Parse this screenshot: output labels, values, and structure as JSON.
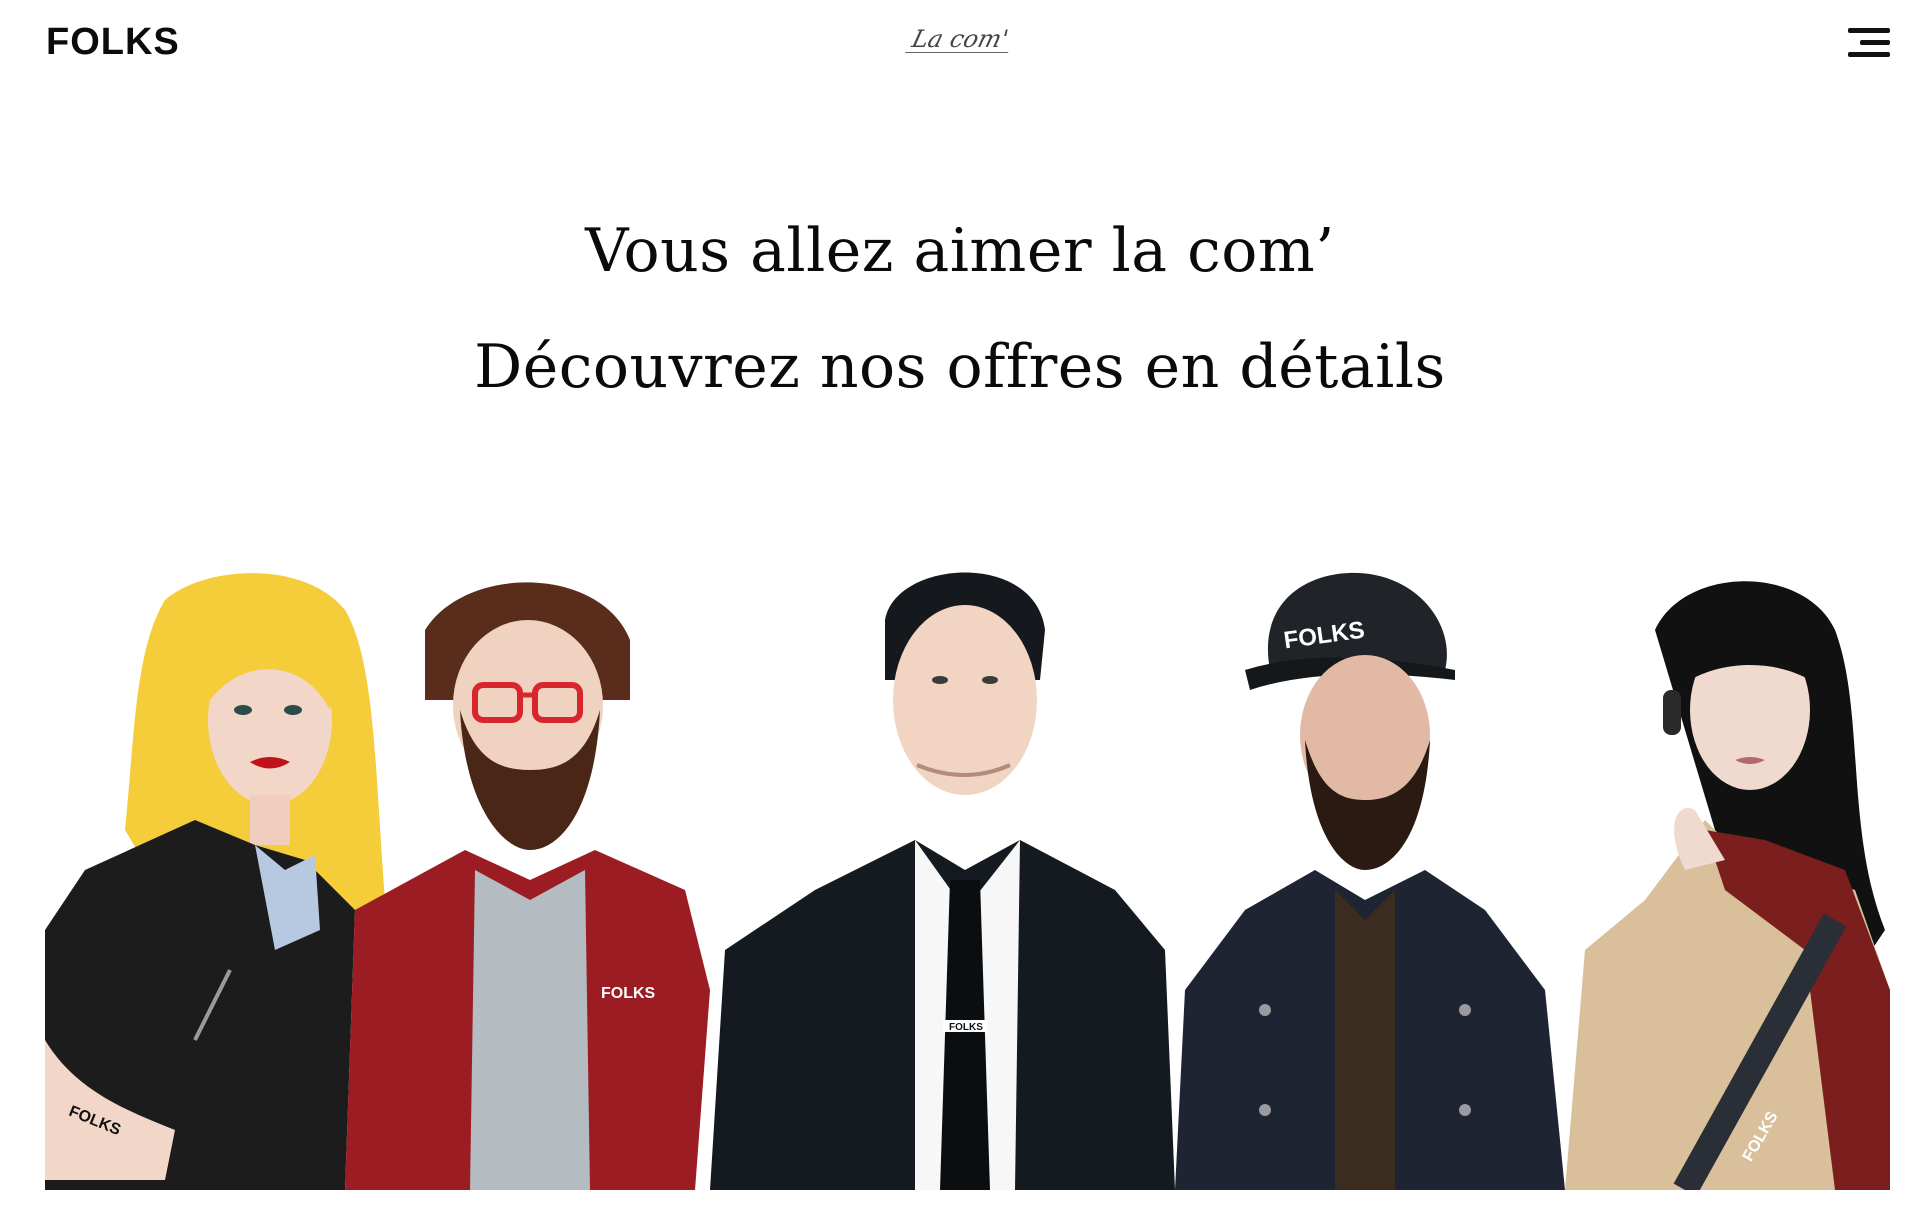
{
  "header": {
    "logo": "FOLKS",
    "page_tag": "La com'",
    "menu_icon": "hamburger-menu-icon"
  },
  "hero": {
    "title": "Vous allez aimer la com’",
    "subtitle": "Découvrez nos offres en détails"
  },
  "team": {
    "illustration_text": "FOLKS",
    "members": [
      {
        "name": "blonde-woman-leather-jacket"
      },
      {
        "name": "bearded-man-red-glasses"
      },
      {
        "name": "man-black-suit-tie"
      },
      {
        "name": "bearded-man-folks-cap"
      },
      {
        "name": "dark-haired-woman-headphones"
      }
    ]
  },
  "colors": {
    "background": "#ffffff",
    "text": "#0a0a0a",
    "blonde_hair": "#f5cc3a",
    "red_jacket": "#9b1c22",
    "suit": "#141a20",
    "denim": "#1e2432",
    "beige_coat": "#d9c09a",
    "scarf": "#7a1e1e",
    "skin": "#f0d2c0"
  }
}
